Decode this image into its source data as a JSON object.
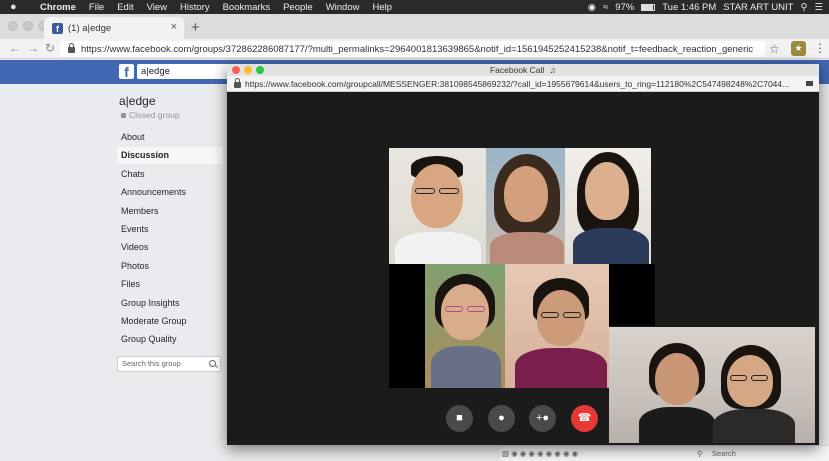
{
  "menubar": {
    "app": "Chrome",
    "items": [
      "File",
      "Edit",
      "View",
      "History",
      "Bookmarks",
      "People",
      "Window",
      "Help"
    ],
    "battery": "97%",
    "clock": "Tue 1:46 PM",
    "user": "STAR ART UNIT"
  },
  "browser": {
    "tab_title": "(1) a|edge",
    "url": "https://www.facebook.com/groups/372862286087177/?multi_permalinks=2964001813639865&notif_id=1561945252415238&notif_t=feedback_reaction_generic"
  },
  "facebook": {
    "search_value": "a|edge",
    "group_name": "a|edge",
    "group_privacy": "Closed group",
    "nav_items": [
      "About",
      "Discussion",
      "Chats",
      "Announcements",
      "Members",
      "Events",
      "Videos",
      "Photos",
      "Files",
      "Group Insights",
      "Moderate Group",
      "Group Quality"
    ],
    "active_nav": "Discussion",
    "group_search_placeholder": "Search this group",
    "chat_search_placeholder": "Search"
  },
  "call_window": {
    "title": "Facebook Call",
    "url": "https://www.facebook.com/groupcall/MESSENGER:381098545869232/?call_id=1955679614&users_to_ring=112180%2C547498248%2C7044..."
  },
  "call_controls": [
    "camera-toggle",
    "microphone-toggle",
    "add-person",
    "end-call"
  ],
  "colors": {
    "facebook_blue": "#4267b2",
    "end_call_red": "#e53935",
    "call_background": "#1b1b1b"
  }
}
